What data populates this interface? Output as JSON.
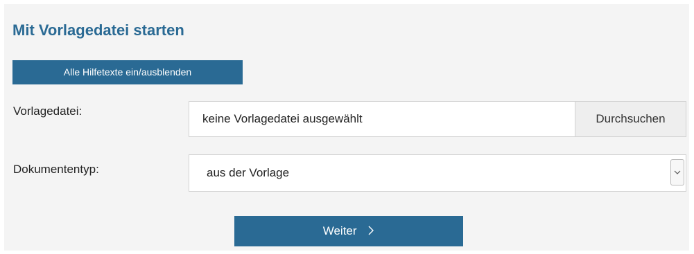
{
  "form": {
    "title": "Mit Vorlagedatei starten",
    "toggle_help_label": "Alle Hilfetexte ein/ausblenden",
    "template_file": {
      "label": "Vorlagedatei:",
      "value": "keine Vorlagedatei ausgewählt",
      "browse_label": "Durchsuchen"
    },
    "document_type": {
      "label": "Dokumententyp:",
      "selected": "aus der Vorlage"
    },
    "next_label": "Weiter"
  },
  "colors": {
    "accent": "#2a6a94",
    "panel_background": "#f4f4f4"
  },
  "icons": {
    "select_arrow": "chevron-down-icon",
    "next_arrow": "chevron-right-icon"
  }
}
